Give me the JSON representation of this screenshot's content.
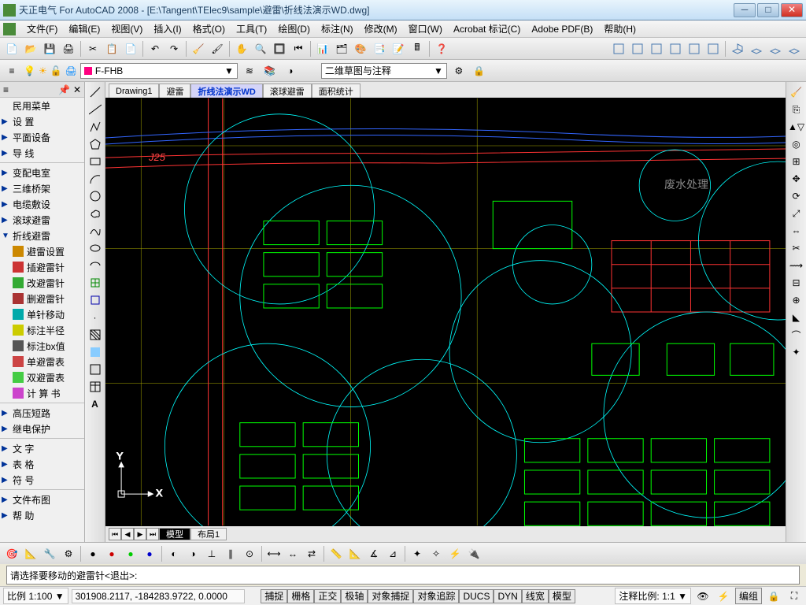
{
  "title": "天正电气 For AutoCAD 2008 - [E:\\Tangent\\TElec9\\sample\\避雷\\折线法演示WD.dwg]",
  "menus": [
    "文件(F)",
    "编辑(E)",
    "视图(V)",
    "插入(I)",
    "格式(O)",
    "工具(T)",
    "绘图(D)",
    "标注(N)",
    "修改(M)",
    "窗口(W)",
    "Acrobat 标记(C)",
    "Adobe PDF(B)",
    "帮助(H)"
  ],
  "layer": {
    "current": "F-FHB",
    "style": "二维草图与注释"
  },
  "leftpanel": {
    "items": [
      {
        "t": "民用菜单",
        "arrow": ""
      },
      {
        "t": "设    置",
        "arrow": "▶"
      },
      {
        "t": "平面设备",
        "arrow": "▶"
      },
      {
        "t": "导    线",
        "arrow": "▶"
      },
      {
        "t": "变配电室",
        "arrow": "▶",
        "sep": true
      },
      {
        "t": "三维桥架",
        "arrow": "▶"
      },
      {
        "t": "电缆敷设",
        "arrow": "▶"
      },
      {
        "t": "滚球避雷",
        "arrow": "▶"
      },
      {
        "t": "折线避雷",
        "arrow": "▼"
      },
      {
        "t": "避雷设置",
        "arrow": "",
        "ico": "#c80"
      },
      {
        "t": "插避雷针",
        "arrow": "",
        "ico": "#c33"
      },
      {
        "t": "改避雷针",
        "arrow": "",
        "ico": "#3a3"
      },
      {
        "t": "删避雷针",
        "arrow": "",
        "ico": "#a33"
      },
      {
        "t": "单针移动",
        "arrow": "",
        "ico": "#0aa"
      },
      {
        "t": "标注半径",
        "arrow": "",
        "ico": "#cc0"
      },
      {
        "t": "标注bx值",
        "arrow": "",
        "ico": "#555"
      },
      {
        "t": "单避雷表",
        "arrow": "",
        "ico": "#c44"
      },
      {
        "t": "双避雷表",
        "arrow": "",
        "ico": "#4c4"
      },
      {
        "t": "计 算 书",
        "arrow": "",
        "ico": "#c4c"
      },
      {
        "t": "高压短路",
        "arrow": "▶",
        "sep": true
      },
      {
        "t": "继电保护",
        "arrow": "▶"
      },
      {
        "t": "文    字",
        "arrow": "▶",
        "sep": true
      },
      {
        "t": "表    格",
        "arrow": "▶"
      },
      {
        "t": "符    号",
        "arrow": "▶"
      },
      {
        "t": "文件布图",
        "arrow": "▶",
        "sep": true
      },
      {
        "t": "帮    助",
        "arrow": "▶"
      }
    ]
  },
  "dwgtabs": [
    {
      "t": "Drawing1"
    },
    {
      "t": "避雷"
    },
    {
      "t": "折线法演示WD",
      "active": true
    },
    {
      "t": "滚球避雷"
    },
    {
      "t": "面积统计"
    }
  ],
  "modeltabs": [
    {
      "t": "模型",
      "active": true
    },
    {
      "t": "布局1"
    }
  ],
  "canvas": {
    "label_waste": "废水处理",
    "label_j25": "J25"
  },
  "cmdline": "请选择要移动的避雷针<退出>:",
  "status": {
    "scale": "比例 1:100 ▼",
    "coords": "301908.2117, -184283.9722, 0.0000",
    "toggles": [
      "捕捉",
      "栅格",
      "正交",
      "极轴",
      "对象捕捉",
      "对象追踪",
      "DUCS",
      "DYN",
      "线宽",
      "模型"
    ],
    "annot_scale": "注释比例: 1:1 ▼",
    "edit": "编组"
  }
}
